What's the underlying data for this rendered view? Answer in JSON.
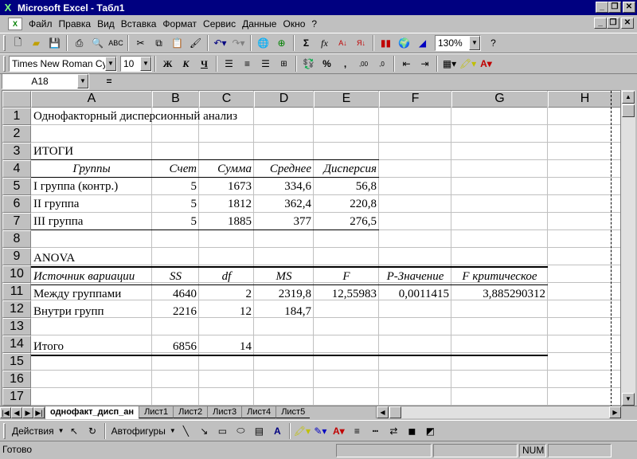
{
  "window": {
    "title": "Microsoft Excel - Табл1"
  },
  "menu": [
    "Файл",
    "Правка",
    "Вид",
    "Вставка",
    "Формат",
    "Сервис",
    "Данные",
    "Окно",
    "?"
  ],
  "toolbar": {
    "zoom": "130%"
  },
  "format_toolbar": {
    "font": "Times New Roman Cyr",
    "size": "10",
    "bold": "Ж",
    "italic": "К",
    "underline": "Ч"
  },
  "formula_bar": {
    "name_box": "A18",
    "equals": "=",
    "content": ""
  },
  "columns": [
    "A",
    "B",
    "C",
    "D",
    "E",
    "F",
    "G",
    "H"
  ],
  "rows": [
    "1",
    "2",
    "3",
    "4",
    "5",
    "6",
    "7",
    "8",
    "9",
    "10",
    "11",
    "12",
    "13",
    "14",
    "15",
    "16",
    "17"
  ],
  "cells": {
    "title": "Однофакторный дисперсионный анализ",
    "summary_label": "ИТОГИ",
    "summary_headers": [
      "Группы",
      "Счет",
      "Сумма",
      "Среднее",
      "Дисперсия"
    ],
    "summary_rows": [
      [
        "I группа (контр.)",
        "5",
        "1673",
        "334,6",
        "56,8"
      ],
      [
        "II группа",
        "5",
        "1812",
        "362,4",
        "220,8"
      ],
      [
        "III группа",
        "5",
        "1885",
        "377",
        "276,5"
      ]
    ],
    "anova_label": "ANOVA",
    "anova_headers": [
      "Источник вариации",
      "SS",
      "df",
      "MS",
      "F",
      "P-Значение",
      "F критическое"
    ],
    "anova_rows": [
      [
        "Между группами",
        "4640",
        "2",
        "2319,8",
        "12,55983",
        "0,0011415",
        "3,885290312"
      ],
      [
        "Внутри групп",
        "2216",
        "12",
        "184,7",
        "",
        "",
        ""
      ],
      [
        "",
        "",
        "",
        "",
        "",
        "",
        ""
      ],
      [
        "Итого",
        "6856",
        "14",
        "",
        "",
        "",
        ""
      ]
    ]
  },
  "sheet_tabs": [
    "однофакт_дисп_ан",
    "Лист1",
    "Лист2",
    "Лист3",
    "Лист4",
    "Лист5"
  ],
  "drawing": {
    "actions": "Действия",
    "autoshapes": "Автофигуры"
  },
  "status": {
    "ready": "Готово",
    "num": "NUM"
  }
}
